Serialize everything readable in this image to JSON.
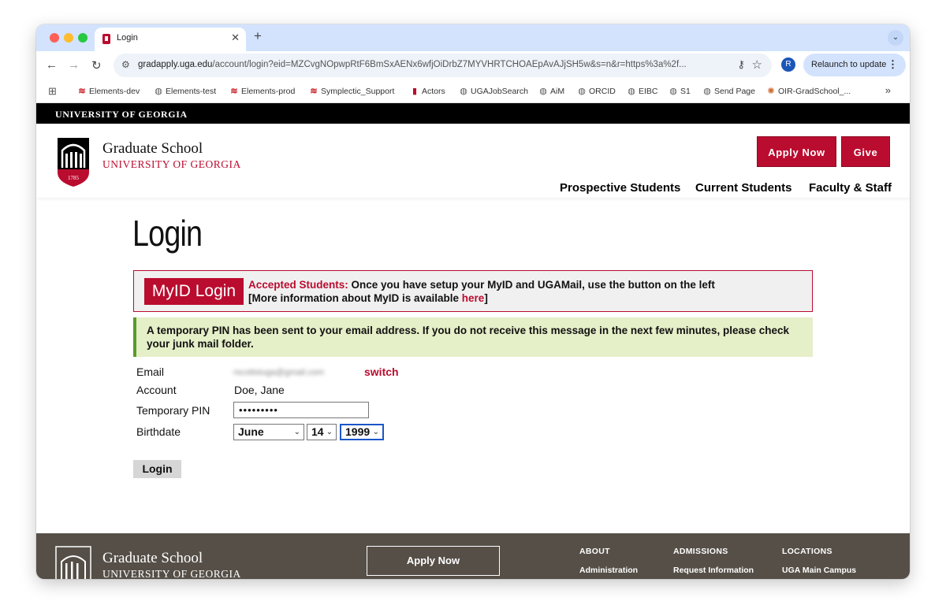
{
  "browser": {
    "tab_title": "Login",
    "tab_close": "✕",
    "new_tab": "+",
    "url_host": "gradapply.uga.edu",
    "url_rest": "/account/login?eid=MZCvgNOpwpRtF6BmSxAENx6wfjOiDrbZ7MYVHRTCHOAEpAvAJjSH5w&s=n&r=https%3a%2f...",
    "profile_initial": "R",
    "relaunch_label": "Relaunch to update",
    "bookmarks": [
      {
        "label": "Elements-dev",
        "icon": "symplectic-icon"
      },
      {
        "label": "Elements-test",
        "icon": "globe-icon"
      },
      {
        "label": "Elements-prod",
        "icon": "symplectic-icon"
      },
      {
        "label": "Symplectic_Support",
        "icon": "symplectic-icon"
      },
      {
        "label": "Actors",
        "icon": "uga-shield-icon"
      },
      {
        "label": "UGAJobSearch",
        "icon": "globe-icon"
      },
      {
        "label": "AiM",
        "icon": "globe-icon"
      },
      {
        "label": "ORCID",
        "icon": "globe-icon"
      },
      {
        "label": "EIBC",
        "icon": "globe-icon"
      },
      {
        "label": "S1",
        "icon": "globe-icon"
      },
      {
        "label": "Send Page",
        "icon": "globe-icon"
      },
      {
        "label": "OIR-GradSchool_...",
        "icon": "oir-icon"
      }
    ]
  },
  "site": {
    "uga_bar": "UNIVERSITY OF GEORGIA",
    "brand_title": "Graduate School",
    "brand_sub": "UNIVERSITY OF GEORGIA",
    "logo_year": "1785",
    "apply_now": "Apply Now",
    "give": "Give",
    "nav": [
      "Prospective Students",
      "Current Students",
      "Faculty & Staff"
    ]
  },
  "login": {
    "title": "Login",
    "myid_button": "MyID Login",
    "accepted_label": "Accepted Students:",
    "accepted_text": " Once you have setup your MyID and UGAMail, use the button on the left",
    "more_info_prefix": "[More information about MyID is available ",
    "more_info_link": "here",
    "more_info_suffix": "]",
    "notice": "A temporary PIN has been sent to your email address. If you do not receive this message in the next few minutes, please check your junk mail folder.",
    "email_label": "Email",
    "email_value": "rscottstuga@gmail.com",
    "switch": "switch",
    "account_label": "Account",
    "account_value": "Doe, Jane",
    "pin_label": "Temporary PIN",
    "pin_value": "•••••••••",
    "birthdate_label": "Birthdate",
    "birth_month": "June",
    "birth_day": "14",
    "birth_year": "1999",
    "submit": "Login"
  },
  "footer": {
    "title": "Graduate School",
    "sub": "UNIVERSITY OF GEORGIA",
    "apply_now": "Apply Now",
    "columns": [
      {
        "head": "ABOUT",
        "link": "Administration"
      },
      {
        "head": "ADMISSIONS",
        "link": "Request Information"
      },
      {
        "head": "LOCATIONS",
        "link": "UGA Main Campus"
      }
    ]
  }
}
